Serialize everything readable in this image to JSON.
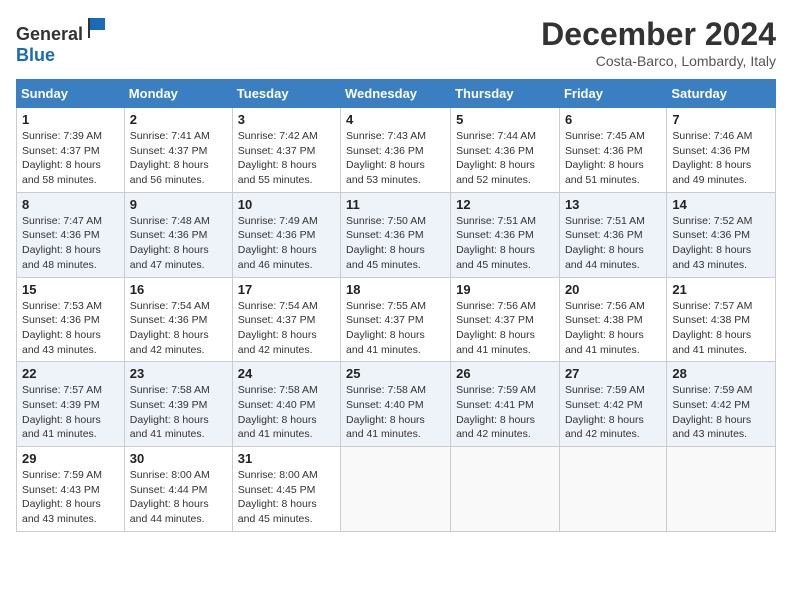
{
  "header": {
    "logo_general": "General",
    "logo_blue": "Blue",
    "month": "December 2024",
    "location": "Costa-Barco, Lombardy, Italy"
  },
  "weekdays": [
    "Sunday",
    "Monday",
    "Tuesday",
    "Wednesday",
    "Thursday",
    "Friday",
    "Saturday"
  ],
  "weeks": [
    [
      {
        "day": "1",
        "sunrise": "Sunrise: 7:39 AM",
        "sunset": "Sunset: 4:37 PM",
        "daylight": "Daylight: 8 hours and 58 minutes."
      },
      {
        "day": "2",
        "sunrise": "Sunrise: 7:41 AM",
        "sunset": "Sunset: 4:37 PM",
        "daylight": "Daylight: 8 hours and 56 minutes."
      },
      {
        "day": "3",
        "sunrise": "Sunrise: 7:42 AM",
        "sunset": "Sunset: 4:37 PM",
        "daylight": "Daylight: 8 hours and 55 minutes."
      },
      {
        "day": "4",
        "sunrise": "Sunrise: 7:43 AM",
        "sunset": "Sunset: 4:36 PM",
        "daylight": "Daylight: 8 hours and 53 minutes."
      },
      {
        "day": "5",
        "sunrise": "Sunrise: 7:44 AM",
        "sunset": "Sunset: 4:36 PM",
        "daylight": "Daylight: 8 hours and 52 minutes."
      },
      {
        "day": "6",
        "sunrise": "Sunrise: 7:45 AM",
        "sunset": "Sunset: 4:36 PM",
        "daylight": "Daylight: 8 hours and 51 minutes."
      },
      {
        "day": "7",
        "sunrise": "Sunrise: 7:46 AM",
        "sunset": "Sunset: 4:36 PM",
        "daylight": "Daylight: 8 hours and 49 minutes."
      }
    ],
    [
      {
        "day": "8",
        "sunrise": "Sunrise: 7:47 AM",
        "sunset": "Sunset: 4:36 PM",
        "daylight": "Daylight: 8 hours and 48 minutes."
      },
      {
        "day": "9",
        "sunrise": "Sunrise: 7:48 AM",
        "sunset": "Sunset: 4:36 PM",
        "daylight": "Daylight: 8 hours and 47 minutes."
      },
      {
        "day": "10",
        "sunrise": "Sunrise: 7:49 AM",
        "sunset": "Sunset: 4:36 PM",
        "daylight": "Daylight: 8 hours and 46 minutes."
      },
      {
        "day": "11",
        "sunrise": "Sunrise: 7:50 AM",
        "sunset": "Sunset: 4:36 PM",
        "daylight": "Daylight: 8 hours and 45 minutes."
      },
      {
        "day": "12",
        "sunrise": "Sunrise: 7:51 AM",
        "sunset": "Sunset: 4:36 PM",
        "daylight": "Daylight: 8 hours and 45 minutes."
      },
      {
        "day": "13",
        "sunrise": "Sunrise: 7:51 AM",
        "sunset": "Sunset: 4:36 PM",
        "daylight": "Daylight: 8 hours and 44 minutes."
      },
      {
        "day": "14",
        "sunrise": "Sunrise: 7:52 AM",
        "sunset": "Sunset: 4:36 PM",
        "daylight": "Daylight: 8 hours and 43 minutes."
      }
    ],
    [
      {
        "day": "15",
        "sunrise": "Sunrise: 7:53 AM",
        "sunset": "Sunset: 4:36 PM",
        "daylight": "Daylight: 8 hours and 43 minutes."
      },
      {
        "day": "16",
        "sunrise": "Sunrise: 7:54 AM",
        "sunset": "Sunset: 4:36 PM",
        "daylight": "Daylight: 8 hours and 42 minutes."
      },
      {
        "day": "17",
        "sunrise": "Sunrise: 7:54 AM",
        "sunset": "Sunset: 4:37 PM",
        "daylight": "Daylight: 8 hours and 42 minutes."
      },
      {
        "day": "18",
        "sunrise": "Sunrise: 7:55 AM",
        "sunset": "Sunset: 4:37 PM",
        "daylight": "Daylight: 8 hours and 41 minutes."
      },
      {
        "day": "19",
        "sunrise": "Sunrise: 7:56 AM",
        "sunset": "Sunset: 4:37 PM",
        "daylight": "Daylight: 8 hours and 41 minutes."
      },
      {
        "day": "20",
        "sunrise": "Sunrise: 7:56 AM",
        "sunset": "Sunset: 4:38 PM",
        "daylight": "Daylight: 8 hours and 41 minutes."
      },
      {
        "day": "21",
        "sunrise": "Sunrise: 7:57 AM",
        "sunset": "Sunset: 4:38 PM",
        "daylight": "Daylight: 8 hours and 41 minutes."
      }
    ],
    [
      {
        "day": "22",
        "sunrise": "Sunrise: 7:57 AM",
        "sunset": "Sunset: 4:39 PM",
        "daylight": "Daylight: 8 hours and 41 minutes."
      },
      {
        "day": "23",
        "sunrise": "Sunrise: 7:58 AM",
        "sunset": "Sunset: 4:39 PM",
        "daylight": "Daylight: 8 hours and 41 minutes."
      },
      {
        "day": "24",
        "sunrise": "Sunrise: 7:58 AM",
        "sunset": "Sunset: 4:40 PM",
        "daylight": "Daylight: 8 hours and 41 minutes."
      },
      {
        "day": "25",
        "sunrise": "Sunrise: 7:58 AM",
        "sunset": "Sunset: 4:40 PM",
        "daylight": "Daylight: 8 hours and 41 minutes."
      },
      {
        "day": "26",
        "sunrise": "Sunrise: 7:59 AM",
        "sunset": "Sunset: 4:41 PM",
        "daylight": "Daylight: 8 hours and 42 minutes."
      },
      {
        "day": "27",
        "sunrise": "Sunrise: 7:59 AM",
        "sunset": "Sunset: 4:42 PM",
        "daylight": "Daylight: 8 hours and 42 minutes."
      },
      {
        "day": "28",
        "sunrise": "Sunrise: 7:59 AM",
        "sunset": "Sunset: 4:42 PM",
        "daylight": "Daylight: 8 hours and 43 minutes."
      }
    ],
    [
      {
        "day": "29",
        "sunrise": "Sunrise: 7:59 AM",
        "sunset": "Sunset: 4:43 PM",
        "daylight": "Daylight: 8 hours and 43 minutes."
      },
      {
        "day": "30",
        "sunrise": "Sunrise: 8:00 AM",
        "sunset": "Sunset: 4:44 PM",
        "daylight": "Daylight: 8 hours and 44 minutes."
      },
      {
        "day": "31",
        "sunrise": "Sunrise: 8:00 AM",
        "sunset": "Sunset: 4:45 PM",
        "daylight": "Daylight: 8 hours and 45 minutes."
      },
      null,
      null,
      null,
      null
    ]
  ]
}
